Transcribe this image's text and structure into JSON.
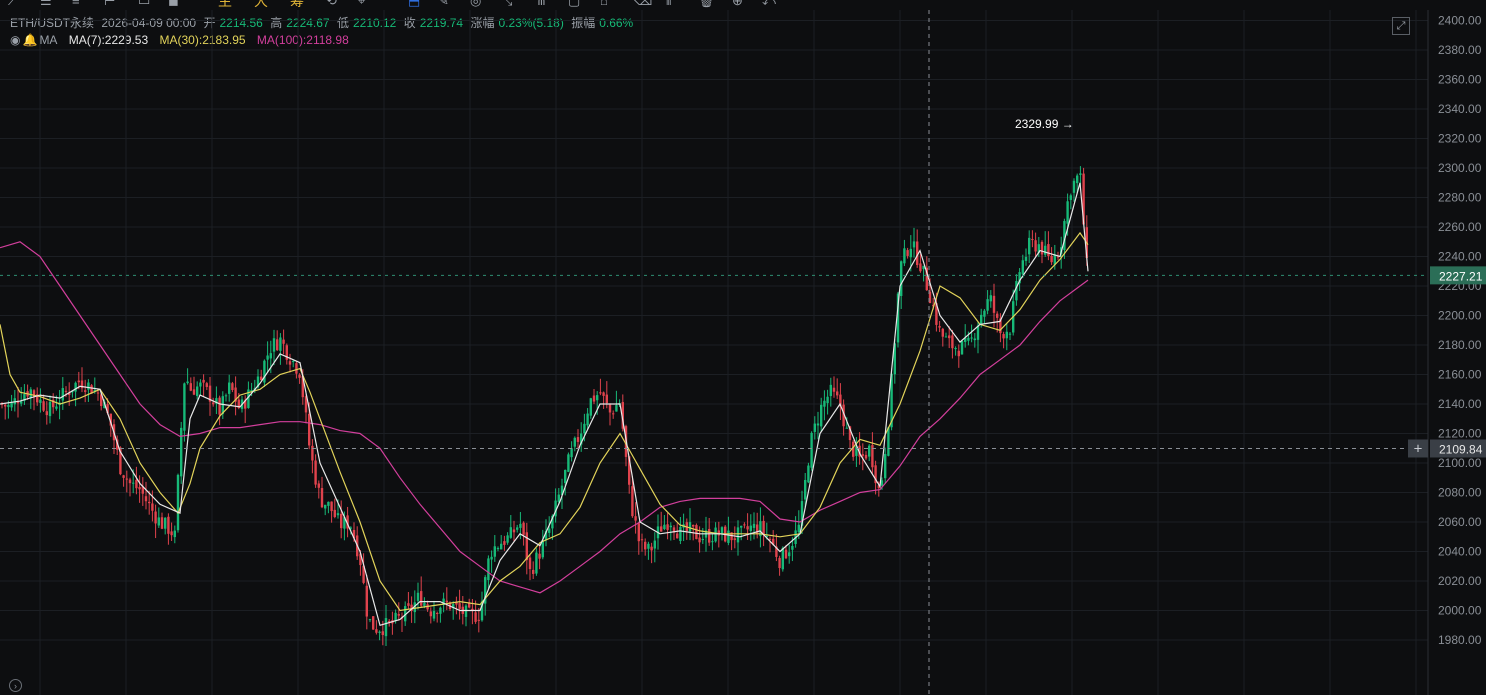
{
  "toolbar": {
    "icons": [
      {
        "name": "trend-line-icon",
        "glyph": "⟋",
        "accent": false
      },
      {
        "name": "horizontal-line-icon",
        "glyph": "☰",
        "accent": false
      },
      {
        "name": "parallel-channel-icon",
        "glyph": "≡",
        "accent": false
      },
      {
        "name": "ray-icon",
        "glyph": "⊢",
        "accent": false
      },
      {
        "name": "rectangle-icon",
        "glyph": "▭",
        "accent": false
      },
      {
        "name": "record-icon",
        "glyph": "◼",
        "accent": false
      },
      {
        "name": "main-chart-icon",
        "glyph": "主",
        "accent": true
      },
      {
        "name": "large-order-icon",
        "glyph": "大",
        "accent": true
      },
      {
        "name": "chip-icon",
        "glyph": "筹",
        "accent": true
      },
      {
        "name": "replay-icon",
        "glyph": "⟲",
        "accent": false
      },
      {
        "name": "alert-icon",
        "glyph": "⌖",
        "accent": false
      },
      {
        "name": "bookmark-icon",
        "glyph": "⬒",
        "accent": false
      },
      {
        "name": "pencil-icon",
        "glyph": "✎",
        "accent": false
      },
      {
        "name": "magnet-icon",
        "glyph": "◎",
        "accent": false
      },
      {
        "name": "measure-icon",
        "glyph": "⤡",
        "accent": false
      },
      {
        "name": "pattern-icon",
        "glyph": "⋔",
        "accent": false
      },
      {
        "name": "text-icon",
        "glyph": "▢",
        "accent": false
      },
      {
        "name": "lock-icon",
        "glyph": "⌂",
        "accent": false
      },
      {
        "name": "eraser-icon",
        "glyph": "⌫",
        "accent": false
      },
      {
        "name": "column-icon",
        "glyph": "⫴",
        "accent": false
      },
      {
        "name": "trash-icon",
        "glyph": "🗑",
        "accent": false
      },
      {
        "name": "zoom-icon",
        "glyph": "⊕",
        "accent": false
      },
      {
        "name": "undo-icon",
        "glyph": "⤺",
        "accent": false
      }
    ]
  },
  "header": {
    "symbol": "ETH/USDT永续",
    "datetime": "2026-04-09 00:00",
    "open_label": "开",
    "open": "2214.56",
    "high_label": "高",
    "high": "2224.67",
    "low_label": "低",
    "low": "2210.12",
    "close_label": "收",
    "close": "2219.74",
    "change_label": "涨幅",
    "change": "0.23%(5.18)",
    "amp_label": "振幅",
    "amp": "0.66%"
  },
  "ma": {
    "label": "MA",
    "ma7": "MA(7):2229.53",
    "ma30": "MA(30):2183.95",
    "ma100": "MA(100):2118.98"
  },
  "colors": {
    "up": "#17b978",
    "down": "#e0434d",
    "ma7": "#e8e8e8",
    "ma30": "#e2d35a",
    "ma100": "#d23f9c",
    "grid": "#1c1f24",
    "axis_text": "#8a8f96",
    "price_tag": "#2b6e57",
    "cross_tag": "#3a3f46"
  },
  "chart_data": {
    "type": "candlestick",
    "y_axis_ticks": [
      "2400.00",
      "2380.00",
      "2360.00",
      "2340.00",
      "2320.00",
      "2300.00",
      "2280.00",
      "2260.00",
      "2240.00",
      "2220.00",
      "2200.00",
      "2180.00",
      "2160.00",
      "2140.00",
      "2120.00",
      "2100.00",
      "2080.00",
      "2060.00",
      "2040.00",
      "2020.00",
      "2000.00",
      "1980.00"
    ],
    "ylim": [
      1960.0,
      2400.0
    ],
    "current_price": "2227.21",
    "crosshair_price": "2109.84",
    "max_label": "2329.99",
    "series_path_points": {
      "close": [
        [
          0,
          2140
        ],
        [
          10,
          2138
        ],
        [
          20,
          2146
        ],
        [
          30,
          2150
        ],
        [
          40,
          2142
        ],
        [
          50,
          2136
        ],
        [
          60,
          2144
        ],
        [
          70,
          2150
        ],
        [
          80,
          2156
        ],
        [
          90,
          2152
        ],
        [
          100,
          2146
        ],
        [
          110,
          2128
        ],
        [
          120,
          2098
        ],
        [
          130,
          2086
        ],
        [
          140,
          2082
        ],
        [
          150,
          2070
        ],
        [
          160,
          2060
        ],
        [
          170,
          2055
        ],
        [
          175,
          2050
        ],
        [
          180,
          2112
        ],
        [
          185,
          2162
        ],
        [
          190,
          2150
        ],
        [
          200,
          2152
        ],
        [
          210,
          2146
        ],
        [
          220,
          2135
        ],
        [
          230,
          2152
        ],
        [
          240,
          2136
        ],
        [
          250,
          2148
        ],
        [
          260,
          2160
        ],
        [
          270,
          2178
        ],
        [
          280,
          2184
        ],
        [
          290,
          2172
        ],
        [
          300,
          2162
        ],
        [
          310,
          2108
        ],
        [
          320,
          2076
        ],
        [
          330,
          2070
        ],
        [
          340,
          2058
        ],
        [
          350,
          2060
        ],
        [
          360,
          2036
        ],
        [
          368,
          1994
        ],
        [
          375,
          1988
        ],
        [
          390,
          1990
        ],
        [
          410,
          2000
        ],
        [
          420,
          2010
        ],
        [
          430,
          2000
        ],
        [
          440,
          2004
        ],
        [
          450,
          2004
        ],
        [
          460,
          2000
        ],
        [
          470,
          1996
        ],
        [
          480,
          1998
        ],
        [
          490,
          2040
        ],
        [
          500,
          2046
        ],
        [
          510,
          2050
        ],
        [
          520,
          2060
        ],
        [
          530,
          2026
        ],
        [
          540,
          2040
        ],
        [
          550,
          2056
        ],
        [
          560,
          2080
        ],
        [
          570,
          2104
        ],
        [
          580,
          2120
        ],
        [
          590,
          2142
        ],
        [
          600,
          2148
        ],
        [
          610,
          2134
        ],
        [
          620,
          2142
        ],
        [
          630,
          2076
        ],
        [
          640,
          2044
        ],
        [
          650,
          2040
        ],
        [
          660,
          2056
        ],
        [
          670,
          2062
        ],
        [
          680,
          2052
        ],
        [
          690,
          2054
        ],
        [
          700,
          2050
        ],
        [
          710,
          2051
        ],
        [
          720,
          2052
        ],
        [
          730,
          2050
        ],
        [
          740,
          2051
        ],
        [
          750,
          2056
        ],
        [
          760,
          2056
        ],
        [
          770,
          2048
        ],
        [
          780,
          2034
        ],
        [
          790,
          2044
        ],
        [
          800,
          2058
        ],
        [
          810,
          2112
        ],
        [
          820,
          2136
        ],
        [
          830,
          2148
        ],
        [
          840,
          2140
        ],
        [
          850,
          2112
        ],
        [
          860,
          2102
        ],
        [
          870,
          2110
        ],
        [
          880,
          2078
        ],
        [
          890,
          2140
        ],
        [
          900,
          2232
        ],
        [
          910,
          2250
        ],
        [
          920,
          2236
        ],
        [
          930,
          2214
        ],
        [
          940,
          2188
        ],
        [
          950,
          2180
        ],
        [
          960,
          2178
        ],
        [
          970,
          2180
        ],
        [
          980,
          2200
        ],
        [
          990,
          2212
        ],
        [
          1000,
          2188
        ],
        [
          1010,
          2192
        ],
        [
          1020,
          2232
        ],
        [
          1030,
          2248
        ],
        [
          1040,
          2248
        ],
        [
          1050,
          2236
        ],
        [
          1060,
          2246
        ],
        [
          1070,
          2286
        ],
        [
          1080,
          2296
        ],
        [
          1088,
          2222
        ]
      ],
      "ma7": [
        [
          0,
          2140
        ],
        [
          20,
          2142
        ],
        [
          40,
          2146
        ],
        [
          60,
          2144
        ],
        [
          80,
          2152
        ],
        [
          100,
          2150
        ],
        [
          120,
          2108
        ],
        [
          140,
          2086
        ],
        [
          160,
          2072
        ],
        [
          180,
          2066
        ],
        [
          190,
          2130
        ],
        [
          200,
          2146
        ],
        [
          220,
          2140
        ],
        [
          240,
          2138
        ],
        [
          260,
          2154
        ],
        [
          280,
          2174
        ],
        [
          300,
          2168
        ],
        [
          320,
          2100
        ],
        [
          340,
          2070
        ],
        [
          360,
          2040
        ],
        [
          380,
          1990
        ],
        [
          400,
          1994
        ],
        [
          420,
          2006
        ],
        [
          440,
          2006
        ],
        [
          460,
          2000
        ],
        [
          480,
          2000
        ],
        [
          500,
          2034
        ],
        [
          520,
          2052
        ],
        [
          540,
          2044
        ],
        [
          560,
          2074
        ],
        [
          580,
          2112
        ],
        [
          600,
          2140
        ],
        [
          620,
          2140
        ],
        [
          640,
          2060
        ],
        [
          660,
          2052
        ],
        [
          680,
          2054
        ],
        [
          700,
          2052
        ],
        [
          720,
          2052
        ],
        [
          740,
          2050
        ],
        [
          760,
          2054
        ],
        [
          780,
          2040
        ],
        [
          800,
          2052
        ],
        [
          820,
          2120
        ],
        [
          840,
          2140
        ],
        [
          860,
          2106
        ],
        [
          880,
          2084
        ],
        [
          900,
          2220
        ],
        [
          920,
          2244
        ],
        [
          940,
          2200
        ],
        [
          960,
          2182
        ],
        [
          980,
          2194
        ],
        [
          1000,
          2196
        ],
        [
          1020,
          2224
        ],
        [
          1040,
          2244
        ],
        [
          1060,
          2240
        ],
        [
          1080,
          2290
        ],
        [
          1088,
          2230
        ]
      ],
      "ma30": [
        [
          0,
          2194
        ],
        [
          10,
          2160
        ],
        [
          20,
          2148
        ],
        [
          40,
          2145
        ],
        [
          60,
          2140
        ],
        [
          80,
          2144
        ],
        [
          100,
          2150
        ],
        [
          120,
          2130
        ],
        [
          140,
          2100
        ],
        [
          160,
          2080
        ],
        [
          178,
          2066
        ],
        [
          190,
          2086
        ],
        [
          200,
          2110
        ],
        [
          220,
          2132
        ],
        [
          240,
          2146
        ],
        [
          260,
          2150
        ],
        [
          280,
          2160
        ],
        [
          300,
          2164
        ],
        [
          310,
          2148
        ],
        [
          320,
          2130
        ],
        [
          340,
          2094
        ],
        [
          360,
          2060
        ],
        [
          380,
          2020
        ],
        [
          400,
          2000
        ],
        [
          420,
          2002
        ],
        [
          440,
          2004
        ],
        [
          460,
          2006
        ],
        [
          480,
          2004
        ],
        [
          500,
          2020
        ],
        [
          520,
          2030
        ],
        [
          540,
          2046
        ],
        [
          560,
          2052
        ],
        [
          580,
          2070
        ],
        [
          600,
          2100
        ],
        [
          620,
          2120
        ],
        [
          640,
          2096
        ],
        [
          660,
          2072
        ],
        [
          680,
          2058
        ],
        [
          700,
          2054
        ],
        [
          720,
          2052
        ],
        [
          740,
          2052
        ],
        [
          760,
          2052
        ],
        [
          780,
          2050
        ],
        [
          800,
          2052
        ],
        [
          820,
          2070
        ],
        [
          840,
          2100
        ],
        [
          860,
          2116
        ],
        [
          880,
          2112
        ],
        [
          900,
          2140
        ],
        [
          920,
          2176
        ],
        [
          940,
          2220
        ],
        [
          960,
          2212
        ],
        [
          980,
          2194
        ],
        [
          1000,
          2190
        ],
        [
          1020,
          2204
        ],
        [
          1040,
          2224
        ],
        [
          1060,
          2238
        ],
        [
          1080,
          2256
        ],
        [
          1088,
          2248
        ]
      ],
      "ma100": [
        [
          0,
          2246
        ],
        [
          20,
          2250
        ],
        [
          40,
          2240
        ],
        [
          60,
          2220
        ],
        [
          80,
          2200
        ],
        [
          100,
          2180
        ],
        [
          120,
          2160
        ],
        [
          140,
          2140
        ],
        [
          160,
          2126
        ],
        [
          180,
          2118
        ],
        [
          200,
          2120
        ],
        [
          220,
          2124
        ],
        [
          240,
          2124
        ],
        [
          260,
          2126
        ],
        [
          280,
          2128
        ],
        [
          300,
          2128
        ],
        [
          320,
          2126
        ],
        [
          340,
          2122
        ],
        [
          360,
          2120
        ],
        [
          380,
          2110
        ],
        [
          400,
          2090
        ],
        [
          420,
          2072
        ],
        [
          440,
          2056
        ],
        [
          460,
          2040
        ],
        [
          480,
          2030
        ],
        [
          500,
          2020
        ],
        [
          520,
          2016
        ],
        [
          540,
          2012
        ],
        [
          560,
          2020
        ],
        [
          580,
          2030
        ],
        [
          600,
          2040
        ],
        [
          620,
          2052
        ],
        [
          640,
          2060
        ],
        [
          660,
          2070
        ],
        [
          680,
          2074
        ],
        [
          700,
          2076
        ],
        [
          720,
          2076
        ],
        [
          740,
          2076
        ],
        [
          760,
          2074
        ],
        [
          780,
          2062
        ],
        [
          800,
          2060
        ],
        [
          820,
          2068
        ],
        [
          840,
          2074
        ],
        [
          860,
          2080
        ],
        [
          880,
          2082
        ],
        [
          900,
          2098
        ],
        [
          920,
          2118
        ],
        [
          940,
          2130
        ],
        [
          960,
          2144
        ],
        [
          980,
          2160
        ],
        [
          1000,
          2170
        ],
        [
          1020,
          2180
        ],
        [
          1040,
          2196
        ],
        [
          1060,
          2210
        ],
        [
          1080,
          2220
        ],
        [
          1088,
          2224
        ]
      ]
    }
  }
}
